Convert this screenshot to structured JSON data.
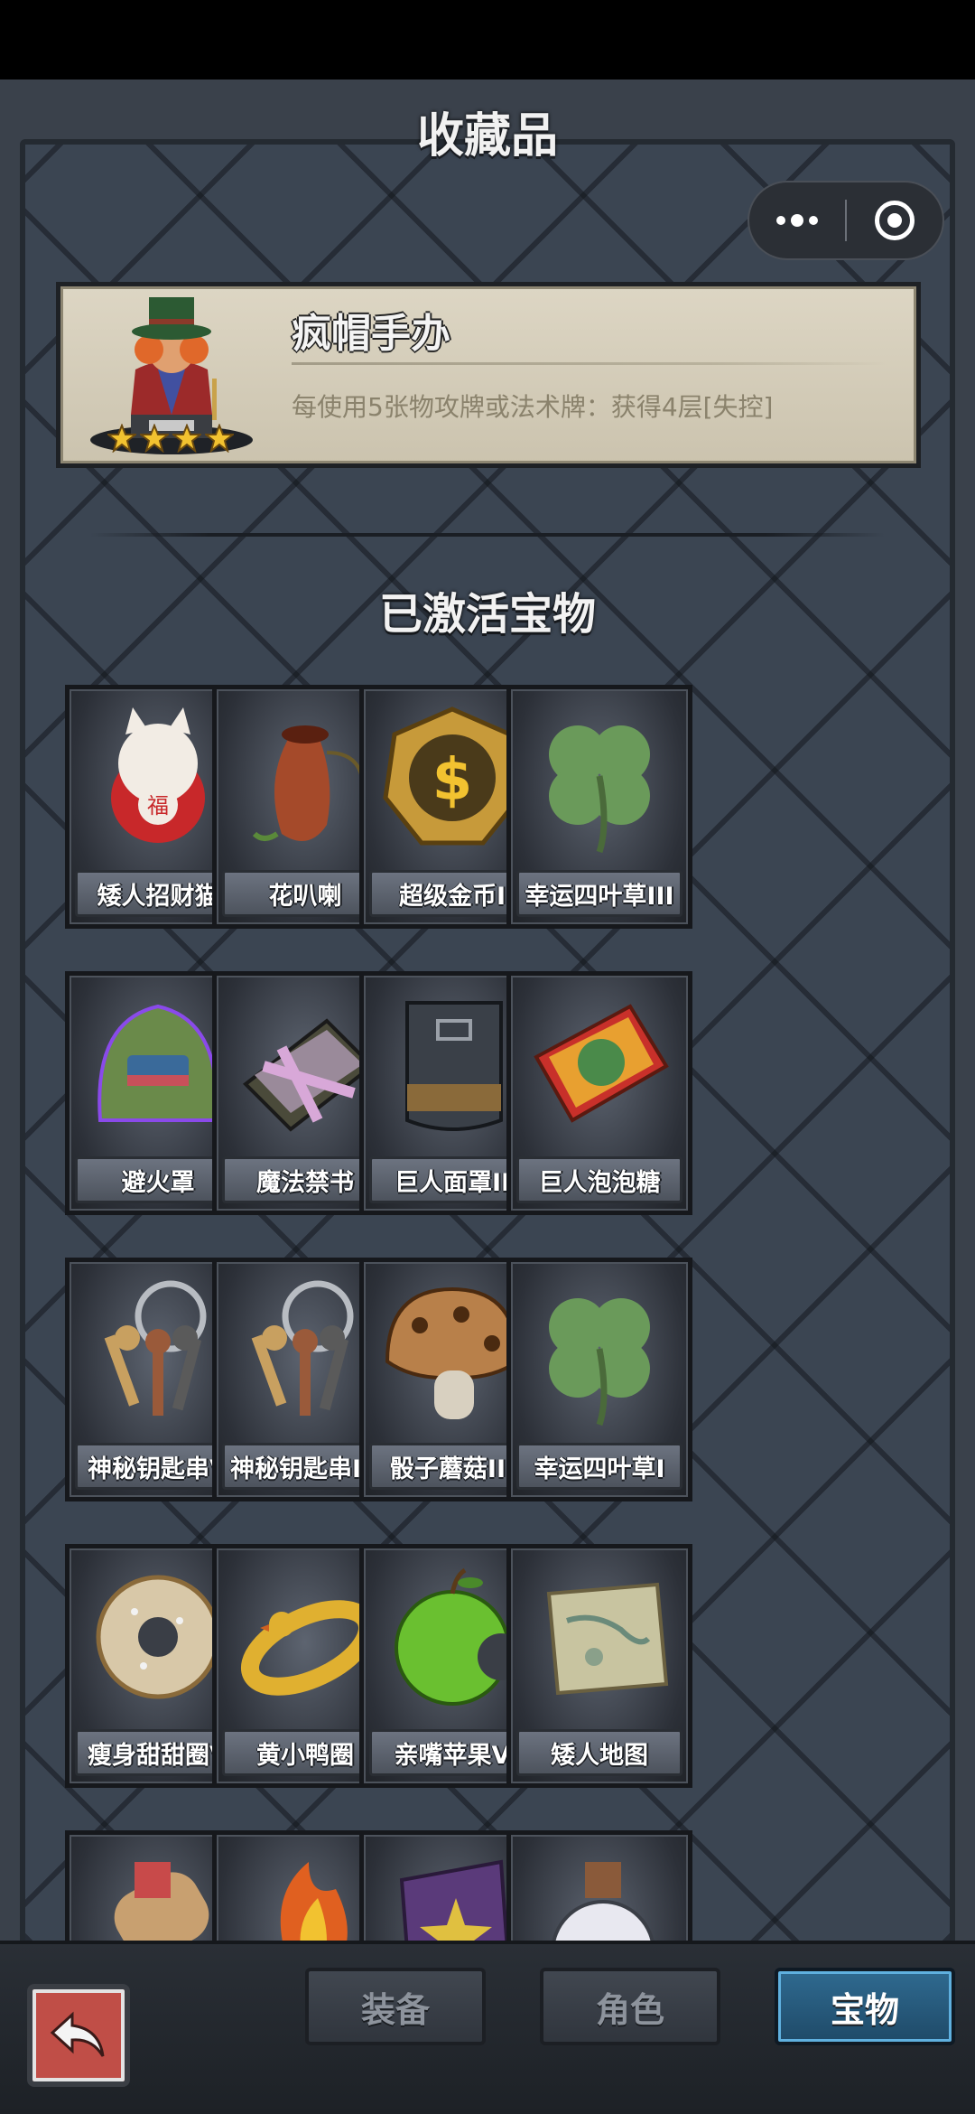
{
  "header": {
    "title": "收藏品"
  },
  "featured": {
    "name": "疯帽手办",
    "description": "每使用5张物攻牌或法术牌：获得4层[失控]",
    "stars": 4
  },
  "section": {
    "title": "已激活宝物"
  },
  "items": [
    {
      "label": "矮人招财猫",
      "icon": "lucky-cat-icon"
    },
    {
      "label": "花叭喇",
      "icon": "pitcher-plant-icon"
    },
    {
      "label": "超级金币I",
      "icon": "gold-coin-icon"
    },
    {
      "label": "幸运四叶草III",
      "icon": "four-leaf-clover-icon"
    },
    {
      "label": "避火罩",
      "icon": "fire-helmet-icon"
    },
    {
      "label": "魔法禁书",
      "icon": "forbidden-book-icon"
    },
    {
      "label": "巨人面罩II",
      "icon": "giant-mask-icon"
    },
    {
      "label": "巨人泡泡糖",
      "icon": "bubblegum-pack-icon"
    },
    {
      "label": "神秘钥匙串V",
      "icon": "key-ring-icon"
    },
    {
      "label": "神秘钥匙串IV",
      "icon": "key-ring-icon"
    },
    {
      "label": "骰子蘑菇III",
      "icon": "dice-mushroom-icon"
    },
    {
      "label": "幸运四叶草I",
      "icon": "four-leaf-clover-icon"
    },
    {
      "label": "瘦身甜甜圈V",
      "icon": "donut-icon"
    },
    {
      "label": "黄小鸭圈",
      "icon": "duck-ring-icon"
    },
    {
      "label": "亲嘴苹果V",
      "icon": "bitten-apple-icon"
    },
    {
      "label": "矮人地图",
      "icon": "scroll-map-icon"
    },
    {
      "label": "",
      "icon": "bandaged-hand-icon"
    },
    {
      "label": "",
      "icon": "fire-torch-icon"
    },
    {
      "label": "",
      "icon": "star-tome-icon"
    },
    {
      "label": "",
      "icon": "potion-bottle-icon"
    }
  ],
  "bottom_nav": {
    "back_icon": "back-arrow-icon",
    "tabs": [
      {
        "label": "装备",
        "active": false
      },
      {
        "label": "角色",
        "active": false
      },
      {
        "label": "宝物",
        "active": true
      }
    ]
  },
  "colors": {
    "active_tab": "#1f4a68",
    "back_button": "#c04e47",
    "featured_card": "#d6cfbc"
  }
}
